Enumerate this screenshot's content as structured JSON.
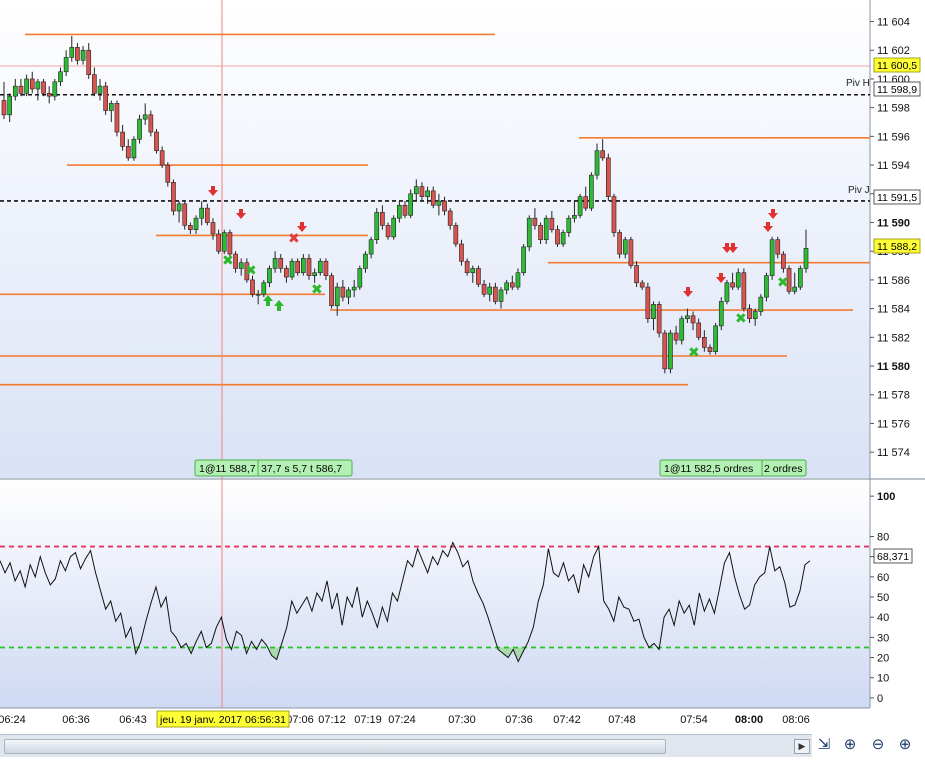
{
  "chart_data": [
    {
      "type": "candlestick",
      "ylim": [
        11572.2,
        11605.5
      ],
      "y_ticks": [
        "11 604",
        "11 602",
        "11 600",
        "11 598",
        "11 596",
        "11 594",
        "11 592",
        "11 590",
        "11 588",
        "11 586",
        "11 584",
        "11 582",
        "11 580",
        "11 578",
        "11 576",
        "11 574"
      ],
      "y_tick_values": [
        11604,
        11602,
        11600,
        11598,
        11596,
        11594,
        11592,
        11590,
        11588,
        11586,
        11584,
        11582,
        11580,
        11578,
        11576,
        11574
      ],
      "bold_ticks": [
        11590,
        11580
      ],
      "candles": [
        [
          11598.5,
          11599.8,
          11597.2,
          11597.5
        ],
        [
          11597.5,
          11599.0,
          11597.0,
          11598.8
        ],
        [
          11598.8,
          11600.0,
          11598.5,
          11599.5
        ],
        [
          11599.5,
          11600.0,
          11598.8,
          11599.0
        ],
        [
          11599.0,
          11600.3,
          11598.8,
          11600.0
        ],
        [
          11600.0,
          11600.5,
          11599.0,
          11599.3
        ],
        [
          11599.3,
          11600.0,
          11598.5,
          11599.8
        ],
        [
          11599.8,
          11600.0,
          11598.8,
          11599.0
        ],
        [
          11599.0,
          11599.5,
          11598.3,
          11598.8
        ],
        [
          11598.8,
          11600.0,
          11598.5,
          11599.8
        ],
        [
          11599.8,
          11600.8,
          11599.5,
          11600.5
        ],
        [
          11600.5,
          11602.0,
          11600.2,
          11601.5
        ],
        [
          11601.5,
          11603.0,
          11601.2,
          11602.2
        ],
        [
          11602.2,
          11602.5,
          11601.0,
          11601.3
        ],
        [
          11601.3,
          11602.3,
          11601.0,
          11602.0
        ],
        [
          11602.0,
          11602.5,
          11600.0,
          11600.3
        ],
        [
          11600.3,
          11600.8,
          11598.8,
          11599.0
        ],
        [
          11599.0,
          11600.0,
          11598.5,
          11599.5
        ],
        [
          11599.5,
          11599.8,
          11597.5,
          11597.8
        ],
        [
          11597.8,
          11598.5,
          11597.0,
          11598.3
        ],
        [
          11598.3,
          11598.5,
          11596.0,
          11596.3
        ],
        [
          11596.3,
          11596.8,
          11595.0,
          11595.3
        ],
        [
          11595.3,
          11595.8,
          11594.3,
          11594.5
        ],
        [
          11594.5,
          11596.0,
          11594.3,
          11595.8
        ],
        [
          11595.8,
          11597.5,
          11595.5,
          11597.2
        ],
        [
          11597.2,
          11598.3,
          11596.8,
          11597.5
        ],
        [
          11597.5,
          11597.8,
          11596.0,
          11596.3
        ],
        [
          11596.3,
          11596.5,
          11594.8,
          11595.0
        ],
        [
          11595.0,
          11595.3,
          11593.8,
          11594.0
        ],
        [
          11594.0,
          11594.2,
          11592.5,
          11592.8
        ],
        [
          11592.8,
          11593.0,
          11590.5,
          11590.8
        ],
        [
          11590.8,
          11591.5,
          11590.0,
          11591.3
        ],
        [
          11591.3,
          11591.5,
          11589.5,
          11589.8
        ],
        [
          11589.8,
          11590.0,
          11589.2,
          11589.5
        ],
        [
          11589.5,
          11590.5,
          11589.2,
          11590.3
        ],
        [
          11590.3,
          11591.5,
          11589.8,
          11591.0
        ],
        [
          11591.0,
          11591.3,
          11589.8,
          11590.0
        ],
        [
          11590.0,
          11590.3,
          11588.8,
          11589.2
        ],
        [
          11589.2,
          11589.5,
          11587.8,
          11588.0
        ],
        [
          11588.0,
          11589.5,
          11587.8,
          11589.3
        ],
        [
          11589.3,
          11589.5,
          11587.5,
          11587.8
        ],
        [
          11587.8,
          11588.0,
          11586.5,
          11586.8
        ],
        [
          11586.8,
          11587.5,
          11586.3,
          11587.2
        ],
        [
          11587.2,
          11587.5,
          11585.8,
          11586.0
        ],
        [
          11586.0,
          11586.3,
          11584.8,
          11585.0
        ],
        [
          11585.0,
          11585.3,
          11584.3,
          11585.0
        ],
        [
          11585.0,
          11586.0,
          11584.8,
          11585.8
        ],
        [
          11585.8,
          11587.0,
          11585.5,
          11586.8
        ],
        [
          11586.8,
          11588.0,
          11586.5,
          11587.5
        ],
        [
          11587.5,
          11587.8,
          11586.5,
          11586.8
        ],
        [
          11586.8,
          11587.0,
          11585.8,
          11586.2
        ],
        [
          11586.2,
          11587.5,
          11586.0,
          11587.3
        ],
        [
          11587.3,
          11587.5,
          11586.3,
          11586.5
        ],
        [
          11586.5,
          11587.8,
          11586.3,
          11587.5
        ],
        [
          11587.5,
          11587.8,
          11586.0,
          11586.3
        ],
        [
          11586.3,
          11586.8,
          11585.8,
          11586.5
        ],
        [
          11586.5,
          11587.5,
          11586.3,
          11587.3
        ],
        [
          11587.3,
          11587.5,
          11586.0,
          11586.3
        ],
        [
          11586.3,
          11586.5,
          11584.0,
          11584.2
        ],
        [
          11584.2,
          11585.8,
          11583.5,
          11585.5
        ],
        [
          11585.5,
          11586.0,
          11584.5,
          11584.8
        ],
        [
          11584.8,
          11585.5,
          11584.3,
          11585.3
        ],
        [
          11585.3,
          11586.0,
          11584.8,
          11585.5
        ],
        [
          11585.5,
          11587.0,
          11585.3,
          11586.8
        ],
        [
          11586.8,
          11588.0,
          11586.5,
          11587.8
        ],
        [
          11587.8,
          11589.0,
          11587.5,
          11588.8
        ],
        [
          11588.8,
          11591.0,
          11588.5,
          11590.7
        ],
        [
          11590.7,
          11591.2,
          11589.5,
          11589.8
        ],
        [
          11589.8,
          11590.0,
          11588.8,
          11589.0
        ],
        [
          11589.0,
          11590.5,
          11588.8,
          11590.3
        ],
        [
          11590.3,
          11591.5,
          11590.0,
          11591.2
        ],
        [
          11591.2,
          11591.5,
          11590.3,
          11590.5
        ],
        [
          11590.5,
          11592.3,
          11590.3,
          11592.0
        ],
        [
          11592.0,
          11593.0,
          11591.5,
          11592.5
        ],
        [
          11592.5,
          11592.8,
          11591.5,
          11591.8
        ],
        [
          11591.8,
          11592.5,
          11591.3,
          11592.2
        ],
        [
          11592.2,
          11592.5,
          11591.0,
          11591.2
        ],
        [
          11591.2,
          11592.0,
          11590.5,
          11591.5
        ],
        [
          11591.5,
          11591.8,
          11590.5,
          11590.8
        ],
        [
          11590.8,
          11591.0,
          11589.5,
          11589.8
        ],
        [
          11589.8,
          11590.0,
          11588.3,
          11588.5
        ],
        [
          11588.5,
          11588.8,
          11587.0,
          11587.3
        ],
        [
          11587.3,
          11587.5,
          11586.3,
          11586.5
        ],
        [
          11586.5,
          11587.0,
          11585.8,
          11586.8
        ],
        [
          11586.8,
          11587.0,
          11585.5,
          11585.7
        ],
        [
          11585.7,
          11586.0,
          11584.8,
          11585.0
        ],
        [
          11585.0,
          11585.8,
          11584.5,
          11585.5
        ],
        [
          11585.5,
          11585.8,
          11584.3,
          11584.5
        ],
        [
          11584.5,
          11585.5,
          11584.0,
          11585.3
        ],
        [
          11585.3,
          11586.0,
          11585.0,
          11585.8
        ],
        [
          11585.8,
          11586.3,
          11585.3,
          11585.5
        ],
        [
          11585.5,
          11586.8,
          11585.3,
          11586.5
        ],
        [
          11586.5,
          11588.5,
          11586.3,
          11588.3
        ],
        [
          11588.3,
          11590.5,
          11588.0,
          11590.3
        ],
        [
          11590.3,
          11591.0,
          11589.5,
          11589.8
        ],
        [
          11589.8,
          11590.0,
          11588.5,
          11588.8
        ],
        [
          11588.8,
          11590.5,
          11588.5,
          11590.3
        ],
        [
          11590.3,
          11590.8,
          11589.3,
          11589.5
        ],
        [
          11589.5,
          11589.8,
          11588.3,
          11588.5
        ],
        [
          11588.5,
          11589.5,
          11588.3,
          11589.3
        ],
        [
          11589.3,
          11590.5,
          11589.0,
          11590.3
        ],
        [
          11590.3,
          11591.5,
          11590.0,
          11590.5
        ],
        [
          11590.5,
          11592.0,
          11590.3,
          11591.8
        ],
        [
          11591.8,
          11592.5,
          11590.8,
          11591.0
        ],
        [
          11591.0,
          11593.5,
          11590.8,
          11593.3
        ],
        [
          11593.3,
          11595.5,
          11593.0,
          11595.0
        ],
        [
          11595.0,
          11595.8,
          11594.3,
          11594.5
        ],
        [
          11594.5,
          11594.8,
          11591.5,
          11591.8
        ],
        [
          11591.8,
          11592.0,
          11589.0,
          11589.3
        ],
        [
          11589.3,
          11589.5,
          11587.5,
          11587.8
        ],
        [
          11587.8,
          11589.0,
          11587.5,
          11588.8
        ],
        [
          11588.8,
          11589.0,
          11586.8,
          11587.0
        ],
        [
          11587.0,
          11587.3,
          11585.5,
          11585.8
        ],
        [
          11585.8,
          11586.0,
          11585.3,
          11585.5
        ],
        [
          11585.5,
          11585.8,
          11583.0,
          11583.3
        ],
        [
          11583.3,
          11584.5,
          11582.5,
          11584.3
        ],
        [
          11584.3,
          11584.5,
          11582.0,
          11582.3
        ],
        [
          11582.3,
          11582.5,
          11579.5,
          11579.8
        ],
        [
          11579.8,
          11582.5,
          11579.5,
          11582.3
        ],
        [
          11582.3,
          11582.8,
          11581.5,
          11581.8
        ],
        [
          11581.8,
          11583.5,
          11581.5,
          11583.3
        ],
        [
          11583.3,
          11584.0,
          11583.0,
          11583.5
        ],
        [
          11583.5,
          11583.8,
          11582.5,
          11583.0
        ],
        [
          11583.0,
          11583.3,
          11581.8,
          11582.0
        ],
        [
          11582.0,
          11582.5,
          11581.0,
          11581.3
        ],
        [
          11581.3,
          11581.5,
          11580.8,
          11581.0
        ],
        [
          11581.0,
          11583.0,
          11580.8,
          11582.8
        ],
        [
          11582.8,
          11584.8,
          11582.5,
          11584.5
        ],
        [
          11584.5,
          11586.0,
          11584.3,
          11585.8
        ],
        [
          11585.8,
          11586.5,
          11585.3,
          11585.5
        ],
        [
          11585.5,
          11586.8,
          11585.3,
          11586.5
        ],
        [
          11586.5,
          11586.8,
          11583.8,
          11584.0
        ],
        [
          11584.0,
          11584.3,
          11583.0,
          11583.3
        ],
        [
          11583.3,
          11584.0,
          11582.8,
          11583.8
        ],
        [
          11583.8,
          11585.0,
          11583.5,
          11584.8
        ],
        [
          11584.8,
          11586.5,
          11584.5,
          11586.3
        ],
        [
          11586.3,
          11589.0,
          11586.0,
          11588.8
        ],
        [
          11588.8,
          11589.0,
          11587.5,
          11587.8
        ],
        [
          11587.8,
          11588.0,
          11586.5,
          11586.8
        ],
        [
          11586.8,
          11587.0,
          11585.0,
          11585.2
        ],
        [
          11585.2,
          11586.5,
          11585.0,
          11585.5
        ],
        [
          11585.5,
          11587.0,
          11585.3,
          11586.8
        ],
        [
          11586.8,
          11589.5,
          11586.5,
          11588.2
        ]
      ]
    },
    {
      "type": "line",
      "series_label": "68,371",
      "ylim": [
        -5,
        108
      ],
      "y_ticks": [
        "100",
        "80",
        "70",
        "60",
        "50",
        "40",
        "30",
        "20",
        "10",
        "0"
      ],
      "y_tick_values": [
        100,
        80,
        70,
        60,
        50,
        40,
        30,
        20,
        10,
        0
      ],
      "levels": {
        "upper": 75,
        "lower": 25,
        "upper_color": "#e8335f",
        "lower_color": "#25c41f"
      },
      "values": [
        68,
        62,
        67,
        58,
        63,
        55,
        66,
        60,
        70,
        62,
        56,
        59,
        68,
        63,
        70,
        72,
        64,
        69,
        73,
        62,
        53,
        44,
        48,
        38,
        42,
        30,
        35,
        22,
        28,
        38,
        47,
        55,
        45,
        50,
        33,
        30,
        25,
        27,
        22,
        28,
        33,
        25,
        27,
        35,
        40,
        29,
        24,
        33,
        31,
        22,
        28,
        24,
        29,
        26,
        21,
        19,
        27,
        35,
        48,
        42,
        46,
        50,
        43,
        52,
        48,
        58,
        44,
        52,
        36,
        50,
        45,
        55,
        40,
        48,
        42,
        35,
        45,
        38,
        52,
        48,
        58,
        68,
        65,
        74,
        68,
        62,
        70,
        66,
        73,
        70,
        77,
        72,
        65,
        68,
        58,
        52,
        47,
        40,
        32,
        24,
        22,
        20,
        24,
        18,
        23,
        28,
        35,
        48,
        56,
        74,
        62,
        60,
        67,
        58,
        61,
        52,
        66,
        60,
        70,
        75,
        48,
        44,
        38,
        50,
        45,
        44,
        38,
        39,
        30,
        25,
        27,
        24,
        40,
        44,
        36,
        48,
        42,
        46,
        36,
        52,
        43,
        49,
        42,
        54,
        67,
        72,
        60,
        51,
        44,
        46,
        56,
        60,
        62,
        75,
        63,
        65,
        57,
        45,
        46,
        53,
        66,
        68
      ]
    }
  ],
  "price_axis": {
    "last_price": "11 588,2",
    "marker_11600": "11 600,5",
    "marker_11598": "11 598,9",
    "marker_11591": "11 591,5",
    "pivot_high": "Piv H",
    "pivot_low": "Piv J",
    "price_hidden_11600": "11 600"
  },
  "order_boxes": [
    "1@11 588,7",
    "37,7 s 5,7 t 586,7",
    "1@11 582,5 ordres",
    "2 ordres"
  ],
  "time_axis": {
    "labels": [
      "06:24",
      "06:36",
      "06:43",
      "06:56",
      "07:06",
      "07:12",
      "07:19",
      "07:24",
      "07:30",
      "07:36",
      "07:42",
      "07:48",
      "07:54",
      "08:00",
      "08:06"
    ],
    "cursor_label": "jeu. 19 janv. 2017 06:56:31"
  },
  "colors": {
    "bull": "#2dbb36",
    "bear": "#d9534f",
    "level_line": "#f47b30",
    "pivot": "#111111",
    "cursor_line": "#f08080",
    "last_price_bg": "#ffff33",
    "bg_top": "#ffffff",
    "bg_bottom": "#d6dff5"
  },
  "icons": [
    "auto-scale-icon",
    "zoom-fit-icon",
    "zoom-out-icon",
    "zoom-in-icon",
    "scroll-right-icon"
  ]
}
